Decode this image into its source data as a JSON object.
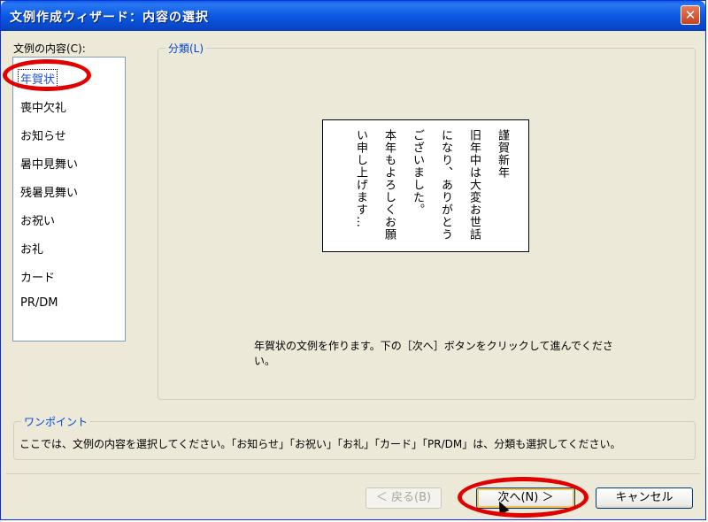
{
  "window": {
    "title": "文例作成ウィザード：内容の選択",
    "close_glyph": "✕"
  },
  "contents": {
    "label": "文例の内容(C):",
    "items": [
      "年賀状",
      "喪中欠礼",
      "お知らせ",
      "暑中見舞い",
      "残暑見舞い",
      "お祝い",
      "お礼",
      "カード",
      "PR/DM"
    ],
    "selected_index": 0
  },
  "category": {
    "legend": "分類(L)",
    "preview_columns": [
      "謹賀新年",
      "旧年中は大変お世話",
      "になり、ありがとう",
      "ございました。",
      "本年もよろしくお願",
      "い申し上げます…"
    ],
    "description": "年賀状の文例を作ります。下の［次へ］ボタンをクリックして進んでください。"
  },
  "tip": {
    "legend": "ワンポイント",
    "text": "ここでは、文例の内容を選択してください。「お知らせ」「お祝い」「お礼」「カード」「PR/DM」は、分類も選択してください。"
  },
  "buttons": {
    "back": "＜ 戻る(B)",
    "next": "次へ(N) ＞",
    "cancel": "キャンセル"
  },
  "colors": {
    "title_bar": "#0a5fe8",
    "highlight_circle": "#e10000",
    "selected_text": "#1f4fd8"
  }
}
